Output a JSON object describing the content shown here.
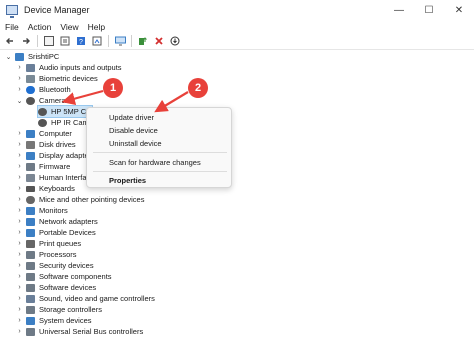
{
  "window": {
    "title": "Device Manager",
    "minimize": "—",
    "maximize": "☐",
    "close": "✕"
  },
  "menu": [
    "File",
    "Action",
    "View",
    "Help"
  ],
  "toolbar_icons": [
    "back-icon",
    "forward-icon",
    "properties-pane-icon",
    "properties-icon",
    "help-icon",
    "show-hidden-icon",
    "monitor-icon",
    "update-driver-icon",
    "uninstall-icon",
    "download-icon"
  ],
  "tree": {
    "root": "SrishtiPC",
    "items": [
      {
        "label": "Audio inputs and outputs",
        "color": "#6a7f99"
      },
      {
        "label": "Biometric devices",
        "color": "#7a8a96"
      },
      {
        "label": "Bluetooth",
        "color": "#1f6fd1"
      },
      {
        "label": "Cameras",
        "color": "#555555"
      },
      {
        "label": "HP 5MP Ca",
        "color": "#555555"
      },
      {
        "label": "HP IR Cam",
        "color": "#555555"
      },
      {
        "label": "Computer",
        "color": "#3c7fc4"
      },
      {
        "label": "Disk drives",
        "color": "#777777"
      },
      {
        "label": "Display adapte",
        "color": "#3c7fc4"
      },
      {
        "label": "Firmware",
        "color": "#6e7a86"
      },
      {
        "label": "Human Interfa",
        "color": "#7b8693"
      },
      {
        "label": "Keyboards",
        "color": "#555555"
      },
      {
        "label": "Mice and other pointing devices",
        "color": "#666666"
      },
      {
        "label": "Monitors",
        "color": "#3c7fc4"
      },
      {
        "label": "Network adapters",
        "color": "#3c7fc4"
      },
      {
        "label": "Portable Devices",
        "color": "#3c7fc4"
      },
      {
        "label": "Print queues",
        "color": "#666666"
      },
      {
        "label": "Processors",
        "color": "#6e7a86"
      },
      {
        "label": "Security devices",
        "color": "#6e7a86"
      },
      {
        "label": "Software components",
        "color": "#6e7a86"
      },
      {
        "label": "Software devices",
        "color": "#6e7a86"
      },
      {
        "label": "Sound, video and game controllers",
        "color": "#6a7f99"
      },
      {
        "label": "Storage controllers",
        "color": "#6e7a86"
      },
      {
        "label": "System devices",
        "color": "#3c7fc4"
      },
      {
        "label": "Universal Serial Bus controllers",
        "color": "#6e7a86"
      }
    ]
  },
  "context_menu": {
    "update": "Update driver",
    "disable": "Disable device",
    "uninstall": "Uninstall device",
    "scan": "Scan for hardware changes",
    "properties": "Properties"
  },
  "annotations": {
    "badge1": "1",
    "badge2": "2",
    "color": "#e8413a"
  }
}
